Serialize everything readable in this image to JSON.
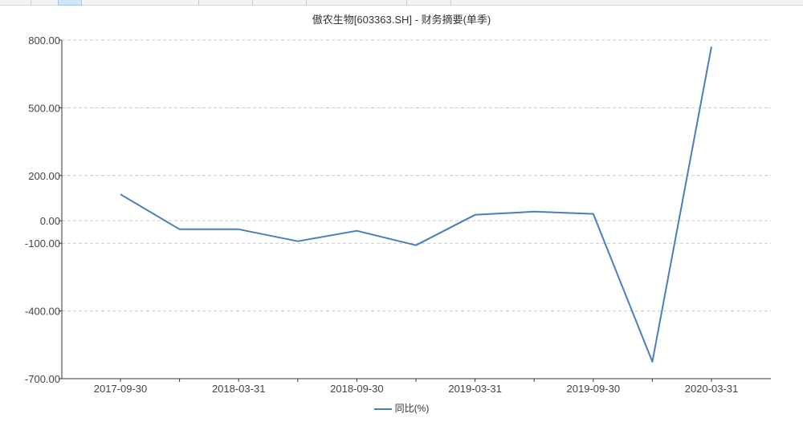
{
  "chart_data": {
    "type": "line",
    "title": "傲农生物[603363.SH] - 财务摘要(单季)",
    "x": [
      "2017-09-30",
      "2017-12-31",
      "2018-03-31",
      "2018-06-30",
      "2018-09-30",
      "2018-12-31",
      "2019-03-31",
      "2019-06-30",
      "2019-09-30",
      "2019-12-31",
      "2020-03-31"
    ],
    "x_tick_labels": [
      "2017-09-30",
      "2018-03-31",
      "2018-09-30",
      "2019-03-31",
      "2019-09-30",
      "2020-03-31"
    ],
    "y_tick_labels": [
      "800.00",
      "500.00",
      "200.00",
      "0.00",
      "-100.00",
      "-400.00",
      "-700.00"
    ],
    "y_ticks": [
      800,
      500,
      200,
      0,
      -100,
      -400,
      -700
    ],
    "ylim": [
      -700,
      800
    ],
    "grid": true,
    "legend_position": "bottom-center",
    "series": [
      {
        "name": "同比(%)",
        "color": "#4a7ebb",
        "values": [
          117,
          -38,
          -38,
          -91,
          -45,
          -109,
          26,
          40,
          30,
          -625,
          771
        ]
      }
    ]
  }
}
